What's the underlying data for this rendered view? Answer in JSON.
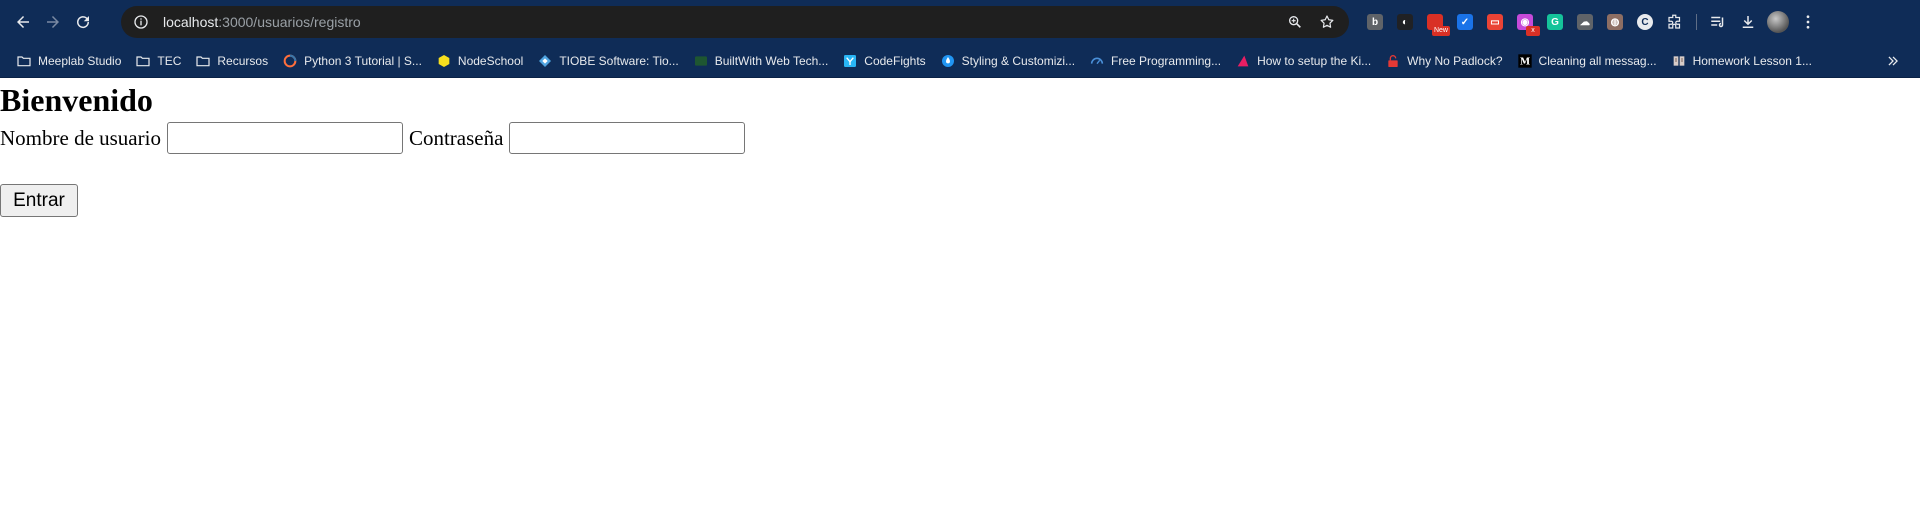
{
  "browser": {
    "url_host": "localhost",
    "url_path": ":3000/usuarios/registro",
    "extensions": [
      {
        "name": "extension-1",
        "color": "#5f6368",
        "text": "b"
      },
      {
        "name": "extension-2",
        "color": "#202124",
        "text": "◐"
      },
      {
        "name": "extension-3",
        "color": "#d93025",
        "text": "",
        "badge": "New"
      },
      {
        "name": "extension-4",
        "color": "#1a73e8",
        "text": "✓"
      },
      {
        "name": "extension-5",
        "color": "#ea4335",
        "text": "▭"
      },
      {
        "name": "extension-6",
        "color": "#c64ad9",
        "text": "◉",
        "badge": "x"
      },
      {
        "name": "grammarly",
        "color": "#15c39a",
        "text": "G"
      },
      {
        "name": "extension-8",
        "color": "#5f6368",
        "text": "☁"
      },
      {
        "name": "extension-9",
        "color": "#8d6e63",
        "text": "◍"
      },
      {
        "name": "extension-10",
        "color": "#e8eaed",
        "text": "C"
      }
    ],
    "bookmarks": [
      {
        "label": "Meeplab Studio",
        "icon": "folder-icon",
        "color": "#e8eaed"
      },
      {
        "label": "TEC",
        "icon": "folder-icon",
        "color": "#e8eaed"
      },
      {
        "label": "Recursos",
        "icon": "folder-icon",
        "color": "#e8eaed"
      },
      {
        "label": "Python 3 Tutorial | S...",
        "icon": "python-icon",
        "color": "#f4b400"
      },
      {
        "label": "NodeSchool",
        "icon": "hexagon-icon",
        "color": "#f7df1e"
      },
      {
        "label": "TIOBE Software: Tio...",
        "icon": "diamond-icon",
        "color": "#4fa3e0"
      },
      {
        "label": "BuiltWith Web Tech...",
        "icon": "builtwith-icon",
        "color": "#1e5631"
      },
      {
        "label": "CodeFights",
        "icon": "codefights-icon",
        "color": "#29b6f6"
      },
      {
        "label": "Styling & Customizi...",
        "icon": "drop-icon",
        "color": "#2196f3"
      },
      {
        "label": "Free Programming...",
        "icon": "gauge-icon",
        "color": "#4a90d9"
      },
      {
        "label": "How to setup the Ki...",
        "icon": "triangle-icon",
        "color": "#e91e63"
      },
      {
        "label": "Why No Padlock?",
        "icon": "padlock-icon",
        "color": "#e53935"
      },
      {
        "label": "Cleaning all messag...",
        "icon": "medium-icon",
        "color": "#ffffff"
      },
      {
        "label": "Homework Lesson 1...",
        "icon": "book-icon",
        "color": "#d7ccc8"
      }
    ]
  },
  "page": {
    "title": "Bienvenido",
    "username_label": "Nombre de usuario",
    "password_label": "Contraseña",
    "submit_label": "Entrar"
  }
}
